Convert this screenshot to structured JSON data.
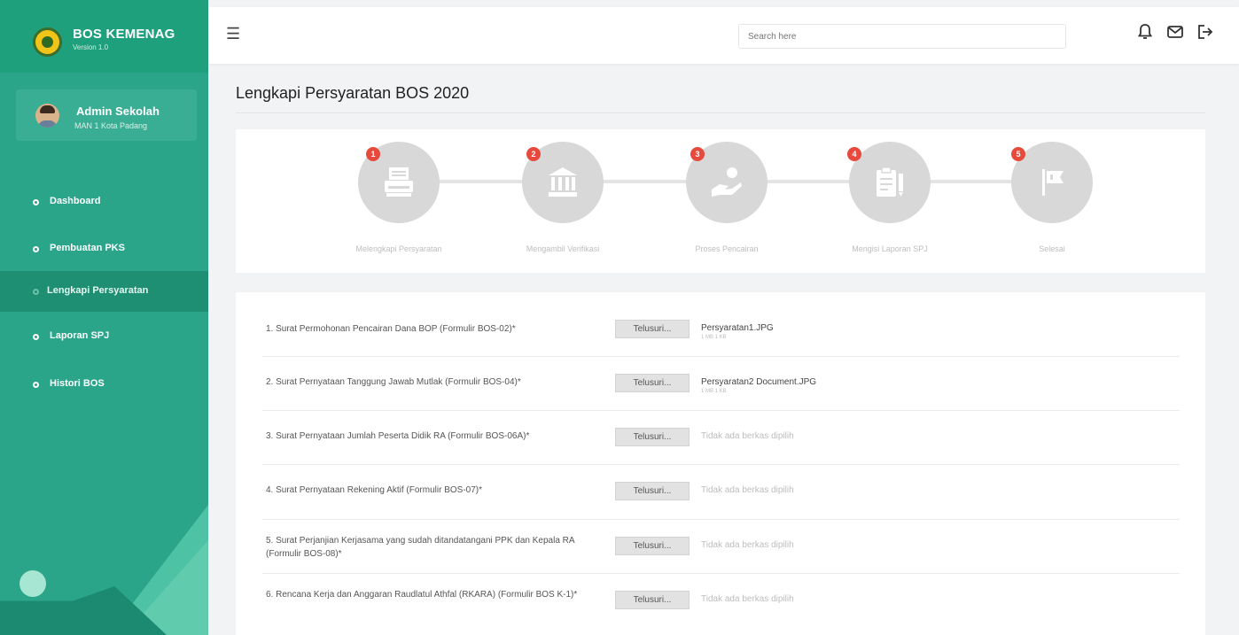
{
  "sidebar": {
    "brand_title": "BOS KEMENAG",
    "brand_version": "Version 1.0",
    "user_name": "Admin Sekolah",
    "user_school": "MAN 1 Kota Padang",
    "items": [
      {
        "label": "Dashboard",
        "active": false
      },
      {
        "label": "Pembuatan PKS",
        "active": false
      },
      {
        "label": "Lengkapi Persyaratan",
        "active": true
      },
      {
        "label": "Laporan SPJ",
        "active": false
      },
      {
        "label": "Histori BOS",
        "active": false
      }
    ],
    "colors": {
      "bg": "#2aa58a",
      "active": "#1e8f73"
    }
  },
  "topbar": {
    "menu_icon": "hamburger-icon",
    "search_placeholder": "Search here",
    "icons": [
      "bell-icon",
      "mail-icon",
      "logout-icon"
    ]
  },
  "page": {
    "title": "Lengkapi Persyaratan BOS 2020"
  },
  "stepper": {
    "steps": [
      {
        "number": "1",
        "label": "Melengkapi Persyaratan",
        "icon": "typewriter-icon"
      },
      {
        "number": "2",
        "label": "Mengambil Verifikasi",
        "icon": "bank-icon"
      },
      {
        "number": "3",
        "label": "Proses Pencairan",
        "icon": "hand-money-icon"
      },
      {
        "number": "4",
        "label": "Mengisi Laporan SPJ",
        "icon": "clipboard-icon"
      },
      {
        "number": "5",
        "label": "Selesai",
        "icon": "flag-icon"
      }
    ],
    "badge_color": "#e8493d"
  },
  "form": {
    "browse_label": "Telusuri...",
    "rows": [
      {
        "label": "1. Surat Permohonan Pencairan Dana BOP (Formulir BOS-02)*",
        "file": "Persyaratan1.JPG",
        "file_sub": "1 MB 1 KB",
        "no_file": ""
      },
      {
        "label": "2. Surat Pernyataan Tanggung Jawab Mutlak (Formulir BOS-04)*",
        "file": "Persyaratan2 Document.JPG",
        "file_sub": "1 MB 1 KB",
        "no_file": ""
      },
      {
        "label": "3. Surat Pernyataan Jumlah Peserta Didik RA (Formulir BOS-06A)*",
        "file": "",
        "file_sub": "",
        "no_file": "Tidak ada berkas dipilih"
      },
      {
        "label": "4. Surat Pernyataan Rekening Aktif (Formulir BOS-07)*",
        "file": "",
        "file_sub": "",
        "no_file": "Tidak ada berkas dipilih"
      },
      {
        "label": "5. Surat Perjanjian Kerjasama yang sudah ditandatangani PPK dan Kepala RA (Formulir BOS-08)*",
        "file": "",
        "file_sub": "",
        "no_file": "Tidak ada berkas dipilih"
      },
      {
        "label": "6. Rencana Kerja dan Anggaran Raudlatul Athfal (RKARA) (Formulir BOS K-1)*",
        "file": "",
        "file_sub": "",
        "no_file": "Tidak ada berkas dipilih"
      }
    ]
  }
}
